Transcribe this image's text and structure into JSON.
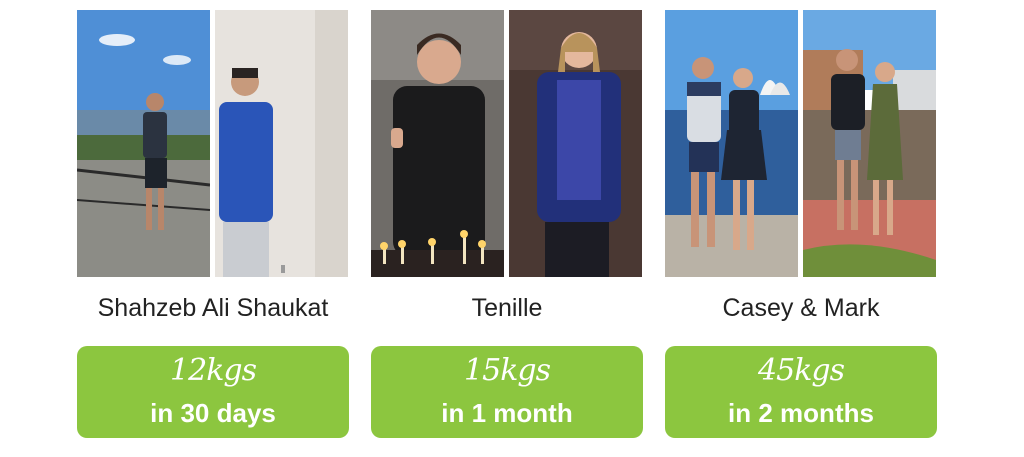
{
  "colors": {
    "badge": "#8cc63f",
    "name_text": "#222222",
    "badge_text": "#ffffff"
  },
  "testimonials": [
    {
      "name": "Shahzeb Ali Shaukat",
      "amount": "12kgs",
      "duration": "in 30 days",
      "photos": {
        "before": "before-photo",
        "after": "after-photo"
      }
    },
    {
      "name": "Tenille",
      "amount": "15kgs",
      "duration": "in 1 month",
      "photos": {
        "before": "before-photo",
        "after": "after-photo"
      }
    },
    {
      "name": "Casey & Mark",
      "amount": "45kgs",
      "duration": "in 2 months",
      "photos": {
        "before": "before-photo",
        "after": "after-photo"
      }
    }
  ]
}
